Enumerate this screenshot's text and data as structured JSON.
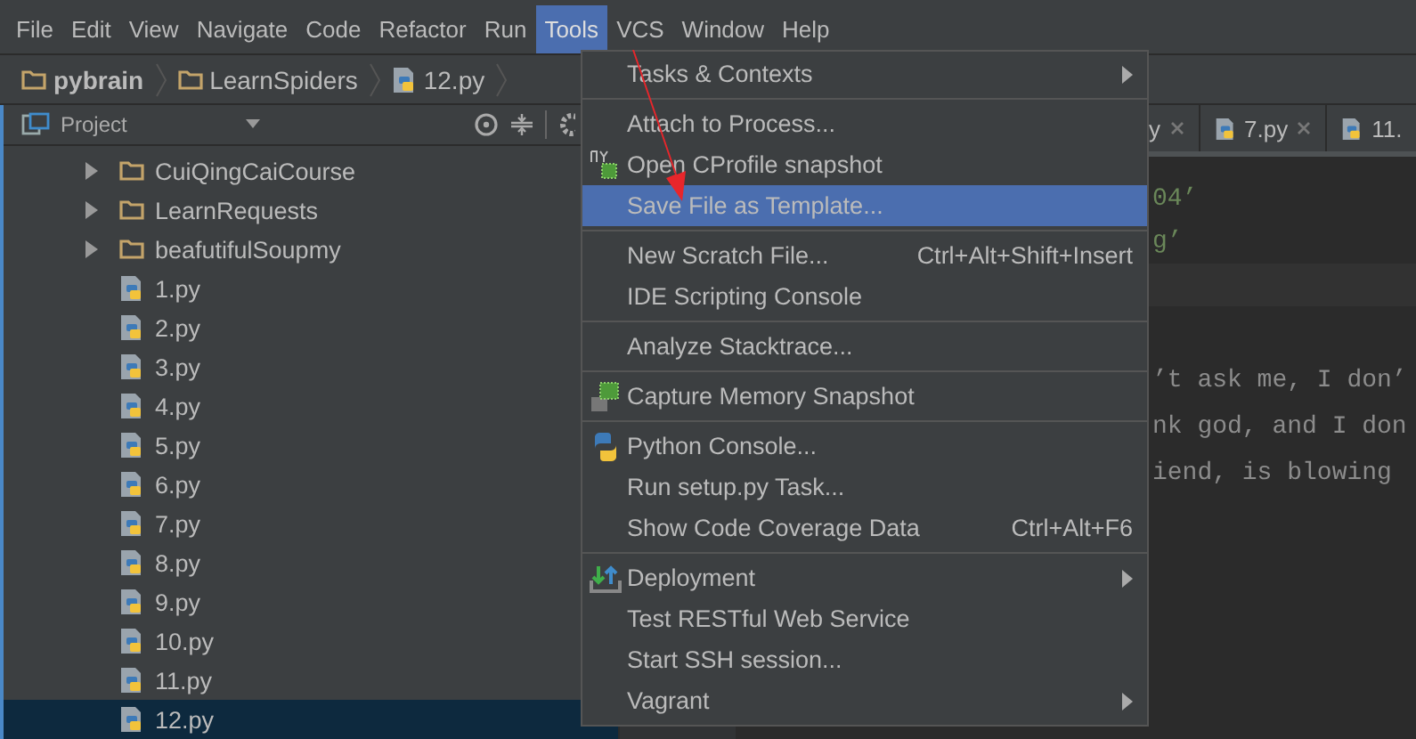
{
  "menubar": [
    {
      "label": "File",
      "selected": false
    },
    {
      "label": "Edit",
      "selected": false
    },
    {
      "label": "View",
      "selected": false
    },
    {
      "label": "Navigate",
      "selected": false
    },
    {
      "label": "Code",
      "selected": false
    },
    {
      "label": "Refactor",
      "selected": false
    },
    {
      "label": "Run",
      "selected": false
    },
    {
      "label": "Tools",
      "selected": true
    },
    {
      "label": "VCS",
      "selected": false
    },
    {
      "label": "Window",
      "selected": false
    },
    {
      "label": "Help",
      "selected": false
    }
  ],
  "breadcrumb": [
    {
      "label": "pybrain",
      "kind": "folder"
    },
    {
      "label": "LearnSpiders",
      "kind": "folder"
    },
    {
      "label": "12.py",
      "kind": "file"
    }
  ],
  "project_panel": {
    "title": "Project",
    "tree": [
      {
        "label": "CuiQingCaiCourse",
        "kind": "folder",
        "expanded": false,
        "selected": false
      },
      {
        "label": "LearnRequests",
        "kind": "folder",
        "expanded": false,
        "selected": false
      },
      {
        "label": "beafutifulSoupmy",
        "kind": "folder",
        "expanded": false,
        "selected": false
      },
      {
        "label": "1.py",
        "kind": "file",
        "selected": false
      },
      {
        "label": "2.py",
        "kind": "file",
        "selected": false
      },
      {
        "label": "3.py",
        "kind": "file",
        "selected": false
      },
      {
        "label": "4.py",
        "kind": "file",
        "selected": false
      },
      {
        "label": "5.py",
        "kind": "file",
        "selected": false
      },
      {
        "label": "6.py",
        "kind": "file",
        "selected": false
      },
      {
        "label": "7.py",
        "kind": "file",
        "selected": false
      },
      {
        "label": "8.py",
        "kind": "file",
        "selected": false
      },
      {
        "label": "9.py",
        "kind": "file",
        "selected": false
      },
      {
        "label": "10.py",
        "kind": "file",
        "selected": false
      },
      {
        "label": "11.py",
        "kind": "file",
        "selected": false
      },
      {
        "label": "12.py",
        "kind": "file",
        "selected": true
      }
    ]
  },
  "editor": {
    "tabs": [
      {
        "label": "y",
        "closable": true,
        "icon": false
      },
      {
        "label": "7.py",
        "closable": true,
        "icon": true
      },
      {
        "label": "11.",
        "closable": false,
        "icon": true
      }
    ],
    "lines_top": [
      {
        "text": "04’",
        "kind": "string"
      },
      {
        "text": "g’",
        "kind": "string"
      }
    ],
    "lines_bottom": [
      {
        "text": "’t ask me, I don’",
        "kind": "comment"
      },
      {
        "text": "nk god, and I don",
        "kind": "comment"
      },
      {
        "text": "iend, is blowing",
        "kind": "comment"
      }
    ]
  },
  "tools_menu": {
    "groups": [
      [
        {
          "label": "Tasks & Contexts",
          "submenu": true,
          "selected": false
        }
      ],
      [
        {
          "label": "Attach to Process...",
          "submenu": false,
          "selected": false
        },
        {
          "label": "Open CProfile snapshot",
          "submenu": false,
          "selected": false
        },
        {
          "label": "Save File as Template...",
          "submenu": false,
          "selected": true
        }
      ],
      [
        {
          "label": "New Scratch File...",
          "shortcut": "Ctrl+Alt+Shift+Insert",
          "submenu": false,
          "selected": false
        },
        {
          "label": "IDE Scripting Console",
          "submenu": false,
          "selected": false
        }
      ],
      [
        {
          "label": "Analyze Stacktrace...",
          "submenu": false,
          "selected": false
        }
      ],
      [
        {
          "label": "Capture Memory Snapshot",
          "submenu": false,
          "selected": false
        }
      ],
      [
        {
          "label": "Python Console...",
          "submenu": false,
          "selected": false
        },
        {
          "label": "Run setup.py Task...",
          "submenu": false,
          "selected": false
        },
        {
          "label": "Show Code Coverage Data",
          "shortcut": "Ctrl+Alt+F6",
          "submenu": false,
          "selected": false
        }
      ],
      [
        {
          "label": "Deployment",
          "submenu": true,
          "selected": false
        },
        {
          "label": "Test RESTful Web Service",
          "submenu": false,
          "selected": false
        },
        {
          "label": "Start SSH session...",
          "submenu": false,
          "selected": false
        },
        {
          "label": "Vagrant",
          "submenu": true,
          "selected": false
        }
      ]
    ]
  }
}
